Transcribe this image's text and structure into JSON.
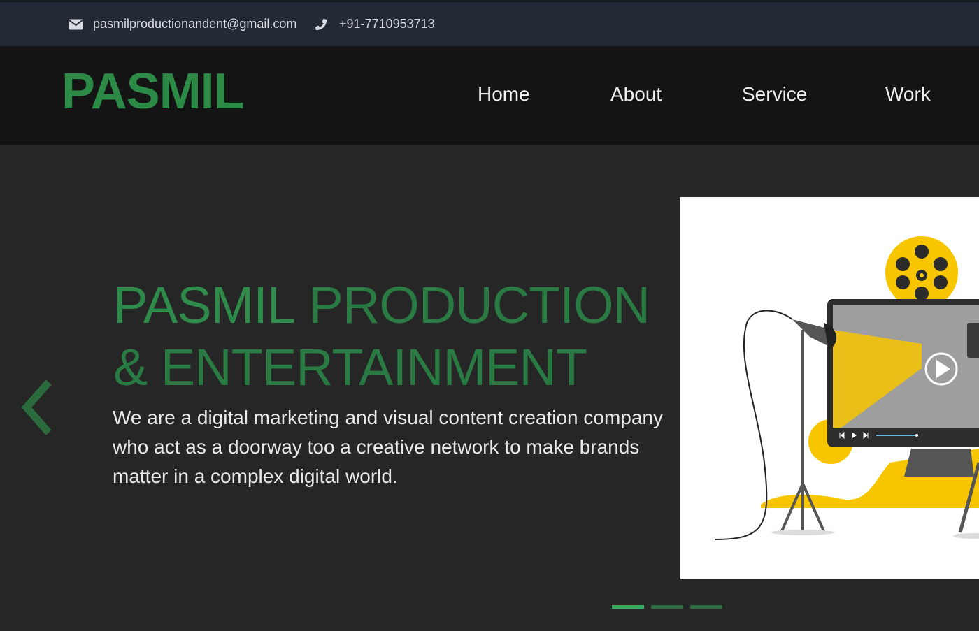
{
  "topbar": {
    "email": "pasmilproductionandent@gmail.com",
    "email_icon": "envelope-icon",
    "phone": "+91-7710953713",
    "phone_icon": "phone-icon"
  },
  "brand": {
    "logo": "PASMIL",
    "color": "#2c8a47"
  },
  "nav": {
    "items": [
      {
        "label": "Home"
      },
      {
        "label": "About"
      },
      {
        "label": "Service"
      },
      {
        "label": "Work"
      }
    ]
  },
  "hero": {
    "headline_strong": "PASMIL",
    "headline_light": "PRODUCTION",
    "headline_line2": "& ENTERTAINMENT",
    "description": "We are a digital marketing and visual content creation company who act as a doorway too a creative network to make brands matter in a complex digital world.",
    "prev_icon": "chevron-left-icon",
    "illustration": "video-production-illustration",
    "slides": 3,
    "active_slide": 1
  },
  "colors": {
    "topbar_bg": "#232935",
    "navbar_bg": "#141414",
    "hero_bg": "#262626",
    "accent": "#2c8a47",
    "yellow": "#f7c600"
  }
}
